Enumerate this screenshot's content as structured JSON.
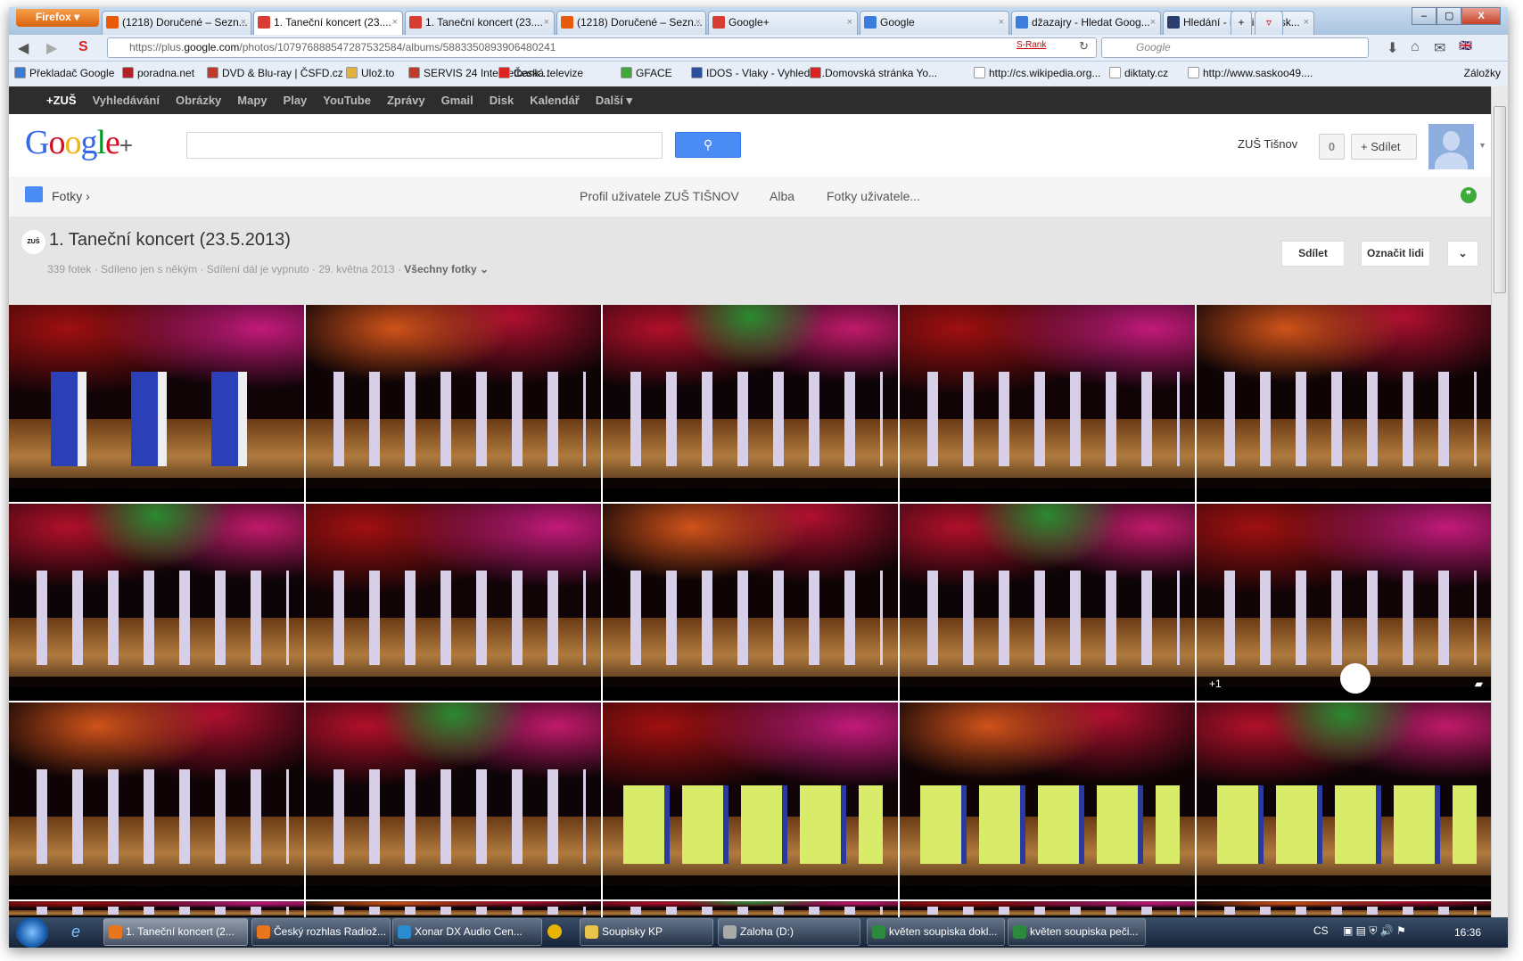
{
  "browser": {
    "menu_button": "Firefox",
    "tabs": [
      {
        "label": "(1218) Doručené – Sezn...",
        "icon": "seznam-email-icon",
        "color": "#e95b0c"
      },
      {
        "label": "1. Taneční koncert (23....",
        "icon": "google-plus-icon",
        "color": "#d73d32",
        "active": true
      },
      {
        "label": "1. Taneční koncert (23....",
        "icon": "google-plus-icon",
        "color": "#d73d32"
      },
      {
        "label": "(1218) Doručené – Sezn...",
        "icon": "seznam-email-icon",
        "color": "#e95b0c"
      },
      {
        "label": "Google+",
        "icon": "google-plus-icon",
        "color": "#d73d32"
      },
      {
        "label": "Google",
        "icon": "google-icon",
        "color": "#3b7ddd"
      },
      {
        "label": "džazajry - Hledat Goog...",
        "icon": "google-icon",
        "color": "#3b7ddd"
      },
      {
        "label": "Hledání - iRadio (Česk...",
        "icon": "iradio-icon",
        "color": "#2a3f6e"
      }
    ],
    "url_prefix": "https://plus.",
    "url_domain": "google.com",
    "url_path": "/photos/107976888547287532584/albums/5883350893906480241",
    "srank": "S-Rank",
    "search_placeholder": "Google",
    "bookmarks": [
      "Překladač Google",
      "poradna.net",
      "DVD & Blu-ray | ČSFD.cz",
      "Ulož.to",
      "SERVIS 24 Internetbank...",
      "Česká televize",
      "GFACE",
      "IDOS - Vlaky - Vyhledá...",
      "Domovská stránka Yo...",
      "http://cs.wikipedia.org...",
      "diktaty.cz",
      "http://www.saskoo49...."
    ],
    "bookmarks_menu": "Záložky"
  },
  "gbar": [
    "+ZUŠ",
    "Vyhledávání",
    "Obrázky",
    "Mapy",
    "Play",
    "YouTube",
    "Zprávy",
    "Gmail",
    "Disk",
    "Kalendář",
    "Další ▾"
  ],
  "header": {
    "logo": "Google",
    "logo_plus": "+",
    "user_name": "ZUŠ Tišnov",
    "notifications": "0",
    "share": "Sdílet"
  },
  "subnav": {
    "photos": "Fotky",
    "profile": "Profil uživatele ZUŠ TIŠNOV",
    "albums": "Alba",
    "user_photos": "Fotky uživatele..."
  },
  "album": {
    "title": "1. Taneční koncert (23.5.2013)",
    "logo_text": "ZUŠ",
    "meta": [
      "339 fotek",
      "Sdíleno jen s někým",
      "Sdílení dál je vypnuto",
      "29. května 2013"
    ],
    "filter": "Všechny fotky",
    "share_btn": "Sdílet",
    "tag_btn": "Označit lidi",
    "plus_count": "+1"
  },
  "photos": [
    "blue",
    "purple",
    "purple",
    "purple",
    "purple",
    "purple",
    "purple",
    "purple",
    "purple",
    "purple",
    "purple",
    "purple",
    "green",
    "green",
    "green",
    "purple",
    "purple",
    "purple",
    "purple",
    "purple"
  ],
  "taskbar": {
    "items": [
      {
        "label": "1. Taneční koncert (2...",
        "color": "#e8761c",
        "active": true
      },
      {
        "label": "Český rozhlas Radiož...",
        "color": "#e8761c"
      },
      {
        "label": "Xonar DX Audio Cen...",
        "color": "#2a8bd0"
      },
      {
        "label": "Soupisky KP",
        "color": "#e9c34a"
      },
      {
        "label": "Zaloha (D:)",
        "color": "#aaa"
      },
      {
        "label": "květen soupiska dokl...",
        "color": "#2c8a3c"
      },
      {
        "label": "květen soupiska peči...",
        "color": "#2c8a3c"
      }
    ],
    "lang": "CS",
    "clock": "16:36"
  }
}
